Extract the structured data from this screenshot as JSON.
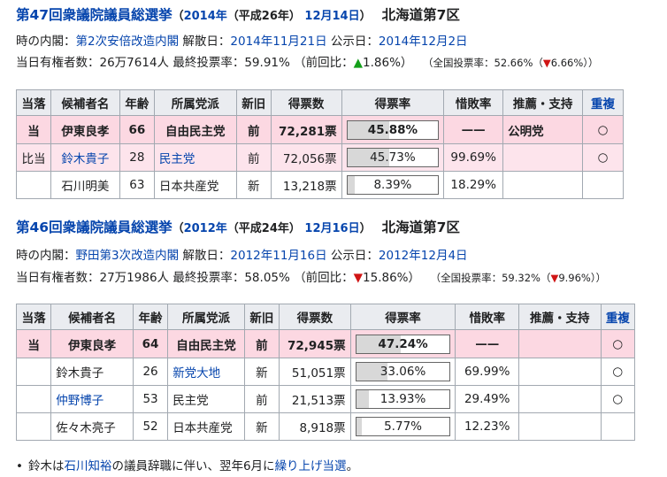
{
  "e47": {
    "heading": {
      "title": "第47回衆議院議員総選挙",
      "open": "（",
      "year": "2014年",
      "era": "（平成26年）",
      "date": "12月14日",
      "close": "）",
      "district": "北海道第7区"
    },
    "info": {
      "cabinet_label": "時の内閣：",
      "cabinet": "第2次安倍改造内閣",
      "dissolution_label": "解散日：",
      "dissolution": "2014年11月21日",
      "announce_label": "公示日：",
      "announce": "2014年12月2日",
      "voters_label": "当日有権者数：",
      "voters": "26万7614人",
      "turnout_label": "最終投票率：",
      "turnout": "59.91%",
      "prev_label": "（前回比：",
      "prev_arrow": "▲",
      "prev": "1.86%",
      "prev_close": "）",
      "national_label": "（全国投票率：",
      "national": "52.66%",
      "national_paren": "（",
      "national_arrow": "▼",
      "national_diff": "6.66%",
      "national_close": "））"
    },
    "headers": [
      "当落",
      "候補者名",
      "年齢",
      "所属党派",
      "新旧",
      "得票数",
      "得票率",
      "惜敗率",
      "推薦・支持",
      "重複"
    ],
    "rows": [
      {
        "result": "当",
        "name": "伊東良孝",
        "age": "66",
        "party": "自由民主党",
        "status": "前",
        "votes": "72,281票",
        "rate": "45.88%",
        "rate_value": 45.88,
        "sekihai": "——",
        "support": "公明党",
        "dup": "○"
      },
      {
        "result": "比当",
        "name": "鈴木貴子",
        "age": "28",
        "party": "民主党",
        "status": "前",
        "votes": "72,056票",
        "rate": "45.73%",
        "rate_value": 45.73,
        "sekihai": "99.69%",
        "support": "",
        "dup": "○"
      },
      {
        "result": "",
        "name": "石川明美",
        "age": "63",
        "party": "日本共産党",
        "status": "新",
        "votes": "13,218票",
        "rate": "8.39%",
        "rate_value": 8.39,
        "sekihai": "18.29%",
        "support": "",
        "dup": ""
      }
    ]
  },
  "e46": {
    "heading": {
      "title": "第46回衆議院議員総選挙",
      "open": "（",
      "year": "2012年",
      "era": "（平成24年）",
      "date": "12月16日",
      "close": "）",
      "district": "北海道第7区"
    },
    "info": {
      "cabinet_label": "時の内閣：",
      "cabinet": "野田第3次改造内閣",
      "dissolution_label": "解散日：",
      "dissolution": "2012年11月16日",
      "announce_label": "公示日：",
      "announce": "2012年12月4日",
      "voters_label": "当日有権者数：",
      "voters": "27万1986人",
      "turnout_label": "最終投票率：",
      "turnout": "58.05%",
      "prev_label": "（前回比：",
      "prev_arrow": "▼",
      "prev": "15.86%",
      "prev_close": "）",
      "national_label": "（全国投票率：",
      "national": "59.32%",
      "national_paren": "（",
      "national_arrow": "▼",
      "national_diff": "9.96%",
      "national_close": "））"
    },
    "headers": [
      "当落",
      "候補者名",
      "年齢",
      "所属党派",
      "新旧",
      "得票数",
      "得票率",
      "惜敗率",
      "推薦・支持",
      "重複"
    ],
    "rows": [
      {
        "result": "当",
        "name": "伊東良孝",
        "age": "64",
        "party": "自由民主党",
        "status": "前",
        "votes": "72,945票",
        "rate": "47.24%",
        "rate_value": 47.24,
        "sekihai": "——",
        "support": "",
        "dup": "○"
      },
      {
        "result": "",
        "name": "鈴木貴子",
        "age": "26",
        "party": "新党大地",
        "status": "新",
        "votes": "51,051票",
        "rate": "33.06%",
        "rate_value": 33.06,
        "sekihai": "69.99%",
        "support": "",
        "dup": "○"
      },
      {
        "result": "",
        "name": "仲野博子",
        "age": "53",
        "party": "民主党",
        "status": "前",
        "votes": "21,513票",
        "rate": "13.93%",
        "rate_value": 13.93,
        "sekihai": "29.49%",
        "support": "",
        "dup": "○"
      },
      {
        "result": "",
        "name": "佐々木亮子",
        "age": "52",
        "party": "日本共産党",
        "status": "新",
        "votes": "8,918票",
        "rate": "5.77%",
        "rate_value": 5.77,
        "sekihai": "12.23%",
        "support": "",
        "dup": ""
      }
    ]
  },
  "note": {
    "pre": "鈴木は",
    "link1": "石川知裕",
    "mid": "の議員辞職に伴い、翌年6月に",
    "link2": "繰り上げ当選",
    "post": "。"
  },
  "colors": {
    "link": "#0645ad",
    "winner_row": "#fcd8e2",
    "header": "#eaecf0",
    "up": "#14a01a",
    "down": "#d01515"
  }
}
